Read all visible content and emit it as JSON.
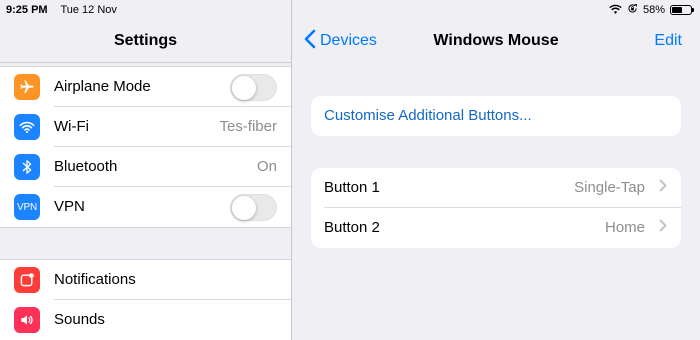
{
  "status": {
    "time": "9:25 PM",
    "date": "Tue 12 Nov",
    "battery": "58%",
    "battery_level": 0.58
  },
  "left": {
    "title": "Settings",
    "group1": [
      {
        "label": "Airplane Mode",
        "icon": "airplane-icon",
        "accessory": "toggle",
        "on": false
      },
      {
        "label": "Wi-Fi",
        "icon": "wifi-icon",
        "value": "Tes-fiber"
      },
      {
        "label": "Bluetooth",
        "icon": "bluetooth-icon",
        "value": "On"
      },
      {
        "label": "VPN",
        "icon": "vpn-icon",
        "icon_text": "VPN",
        "accessory": "toggle",
        "on": false
      }
    ],
    "group2": [
      {
        "label": "Notifications",
        "icon": "notifications-icon"
      },
      {
        "label": "Sounds",
        "icon": "sounds-icon"
      }
    ]
  },
  "right": {
    "back_label": "Devices",
    "title": "Windows Mouse",
    "edit_label": "Edit",
    "customise_label": "Customise Additional Buttons...",
    "buttons": [
      {
        "label": "Button 1",
        "value": "Single-Tap"
      },
      {
        "label": "Button 2",
        "value": "Home"
      }
    ]
  },
  "colors": {
    "accent": "#007aff",
    "link": "#1469c7",
    "airplane": "#fd9426",
    "wifi": "#1b84fe",
    "bluetooth": "#1b84fe",
    "vpn": "#1b84fe",
    "notifications": "#fc3d39",
    "sounds": "#fc3158"
  }
}
